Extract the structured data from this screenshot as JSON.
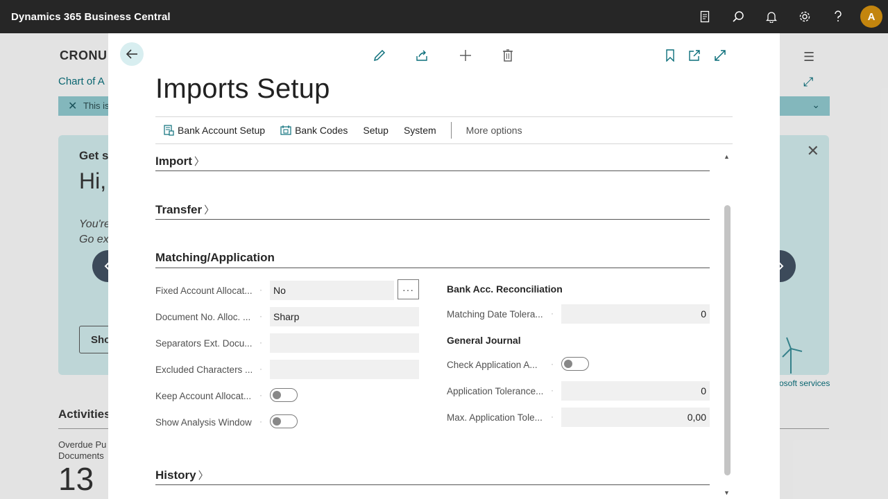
{
  "app": {
    "title": "Dynamics 365 Business Central",
    "avatar_initial": "A"
  },
  "background": {
    "company": "CRONU",
    "breadcrumb": "Chart of A",
    "banner_text": "This is",
    "card_heading": "Get s",
    "card_greeting": "Hi,",
    "card_text_line1": "You're",
    "card_text_line2": "Go ex",
    "card_button": "Sho",
    "ms_services": "osoft services",
    "activities": "Activities",
    "overdue_line1": "Overdue Pu",
    "overdue_line2": "Documents",
    "overdue_count": "13"
  },
  "modal": {
    "title": "Imports Setup",
    "actions": {
      "bank_account_setup": "Bank Account Setup",
      "bank_codes": "Bank Codes",
      "setup": "Setup",
      "system": "System",
      "more_options": "More options"
    },
    "sections": {
      "import": "Import",
      "transfer": "Transfer",
      "matching": "Matching/Application",
      "history": "History"
    },
    "left_fields": {
      "fixed_account_label": "Fixed Account Allocat...",
      "fixed_account_value": "No",
      "document_no_label": "Document No. Alloc. ...",
      "document_no_value": "Sharp",
      "separators_label": "Separators Ext. Docu...",
      "separators_value": "",
      "excluded_label": "Excluded Characters ...",
      "excluded_value": "",
      "keep_account_label": "Keep Account Allocat...",
      "keep_account_value": false,
      "show_analysis_label": "Show Analysis Window",
      "show_analysis_value": false
    },
    "right_fields": {
      "bank_group": "Bank Acc. Reconciliation",
      "matching_date_label": "Matching Date Tolera...",
      "matching_date_value": "0",
      "general_group": "General Journal",
      "check_application_label": "Check Application A...",
      "check_application_value": false,
      "application_tolerance_label": "Application Tolerance...",
      "application_tolerance_value": "0",
      "max_application_label": "Max. Application Tole...",
      "max_application_value": "0,00"
    }
  },
  "colors": {
    "topbar": "#262626",
    "accent": "#0a6e7a",
    "avatar": "#c3850e",
    "nav_circle": "#3c4a5a"
  }
}
